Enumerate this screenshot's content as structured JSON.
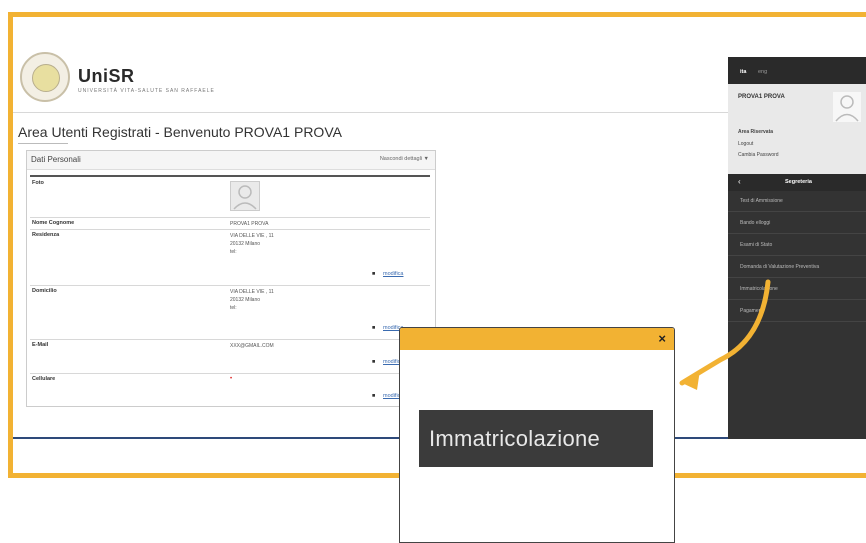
{
  "logo": {
    "name": "UniSR",
    "subtitle": "UNIVERSITÀ VITA-SALUTE SAN RAFFAELE"
  },
  "page_title": "Area Utenti Registrati - Benvenuto PROVA1 PROVA",
  "panel": {
    "title": "Dati Personali",
    "toggle": "Nascondi dettagli ▼",
    "rows": [
      {
        "label": "Foto",
        "value": ""
      },
      {
        "label": "Nome Cognome",
        "value": "PROVA1 PROVA"
      },
      {
        "label": "Residenza",
        "value_lines": [
          "VIA DELLE VIE , 11",
          "20132 Milano",
          "tel:"
        ],
        "action": "modifica"
      },
      {
        "label": "Domicilio",
        "value_lines": [
          "VIA DELLE VIE , 11",
          "20132 Milano",
          "tel:"
        ],
        "action": "modifica"
      },
      {
        "label": "E-Mail",
        "value": "XXX@GMAIL.COM",
        "action": "modifica"
      },
      {
        "label": "Cellulare",
        "value": "•",
        "action": "modifica"
      }
    ]
  },
  "sidebar": {
    "lang_active": "ita",
    "lang_other": "eng",
    "user_name": "PROVA1 PROVA",
    "area_label": "Area Riservata",
    "logout": "Logout",
    "change_pw": "Cambia Password",
    "section": "Segreteria",
    "items": [
      "Test di Ammissione",
      "Bando elloggi",
      "Esami di Stato",
      "Domanda di Valutazione Preventiva",
      "Immatricolazione",
      "Pagamenti"
    ]
  },
  "popup": {
    "close": "×",
    "label": "Immatricolazione"
  },
  "colors": {
    "accent": "#f2b233",
    "nav_dark": "#333333",
    "divider": "#2e4a7a"
  }
}
